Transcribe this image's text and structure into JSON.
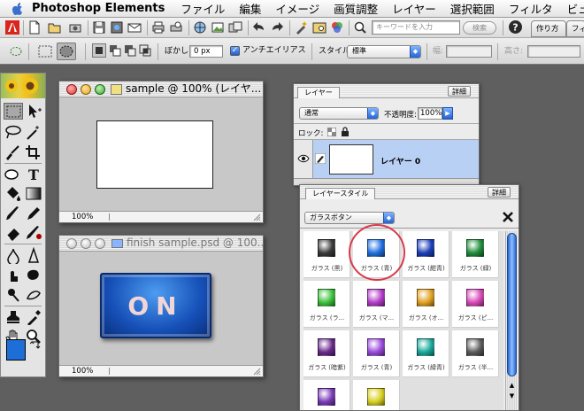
{
  "menubar": {
    "app_name": "Photoshop Elements",
    "items": [
      "ファイル",
      "編集",
      "イメージ",
      "画質調整",
      "レイヤー",
      "選択範囲",
      "フィルタ",
      "ビュ"
    ]
  },
  "shortcuts_bar": {
    "search_placeholder": "キーワードを入力",
    "search_button": "検索",
    "tabs": [
      "作り方",
      "フィ"
    ]
  },
  "options_bar": {
    "feather_label": "ぼかし:",
    "feather_value": "0 px",
    "antialias_label": "アンチエイリアス",
    "antialias_checked": true,
    "style_label": "スタイル:",
    "style_value": "標準",
    "width_label": "幅:",
    "height_label": "高さ:"
  },
  "windows": [
    {
      "title": "sample @ 100% (レイヤ...",
      "zoom": "100%"
    },
    {
      "title": "finish sample.psd @ 100...",
      "zoom": "100%",
      "button_text": "ON"
    }
  ],
  "layers_panel": {
    "tab": "レイヤー",
    "more": "詳細",
    "blend_mode": "通常",
    "opacity_label": "不透明度:",
    "opacity_value": "100%",
    "lock_label": "ロック:",
    "layer_name": "レイヤー 0"
  },
  "layer_styles_panel": {
    "tab": "レイヤースタイル",
    "more": "詳細",
    "category": "ガラスボタン",
    "styles": [
      {
        "label": "ガラス (黒)",
        "color": "#3a3a3a"
      },
      {
        "label": "ガラス (青)",
        "color": "#1f6fe0"
      },
      {
        "label": "ガラス (紺青)",
        "color": "#1b3fb8"
      },
      {
        "label": "ガラス (緑)",
        "color": "#1e8c3a"
      },
      {
        "label": "ガラス (ラ...",
        "color": "#3cc03c"
      },
      {
        "label": "ガラス (マ...",
        "color": "#b43cc8"
      },
      {
        "label": "ガラス (オ...",
        "color": "#e0a020"
      },
      {
        "label": "ガラス (ピ...",
        "color": "#d848b8"
      },
      {
        "label": "ガラス (暗紫)",
        "color": "#6a2a8c"
      },
      {
        "label": "ガラス (青)",
        "color": "#9a4adc"
      },
      {
        "label": "ガラス (緑青)",
        "color": "#18a89a"
      },
      {
        "label": "ガラス (半...",
        "color": "#5a5a5a"
      },
      {
        "label": "",
        "color": "#7a3ab8"
      },
      {
        "label": "",
        "color": "#d8d020"
      }
    ],
    "highlighted_index": 1
  },
  "colors": {
    "foreground": "#1e6ed8",
    "background": "#000000",
    "highlight_circle": "#d83a4a"
  }
}
